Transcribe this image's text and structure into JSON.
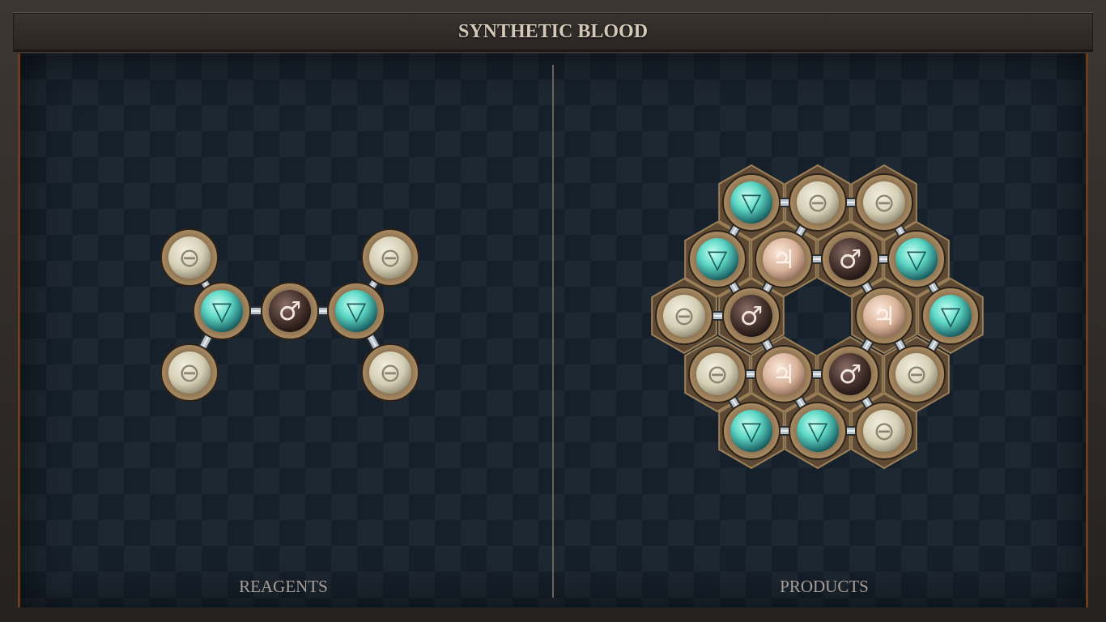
{
  "title": "SYNTHETIC BLOOD",
  "panels": {
    "reagents_label": "REAGENTS",
    "products_label": "PRODUCTS"
  },
  "colors": {
    "accent_wood": "#6b3d1e",
    "salt": "#d8d3bd",
    "water": "#5fd8c6",
    "iron": "#4a3530",
    "tin": "#e0b9a0",
    "symbol_on_salt": "#8a8470",
    "symbol_on_water": "#1f5b56",
    "symbol_on_iron": "#f0e6dc",
    "symbol_on_tin": "#fdf3ea"
  },
  "atoms": {
    "salt": {
      "symbol": "⊖",
      "icon": "salt-icon"
    },
    "water": {
      "symbol": "▽",
      "icon": "water-icon"
    },
    "iron": {
      "symbol": "♂",
      "icon": "iron-icon"
    },
    "tin": {
      "symbol": "♃",
      "icon": "tin-icon"
    }
  }
}
